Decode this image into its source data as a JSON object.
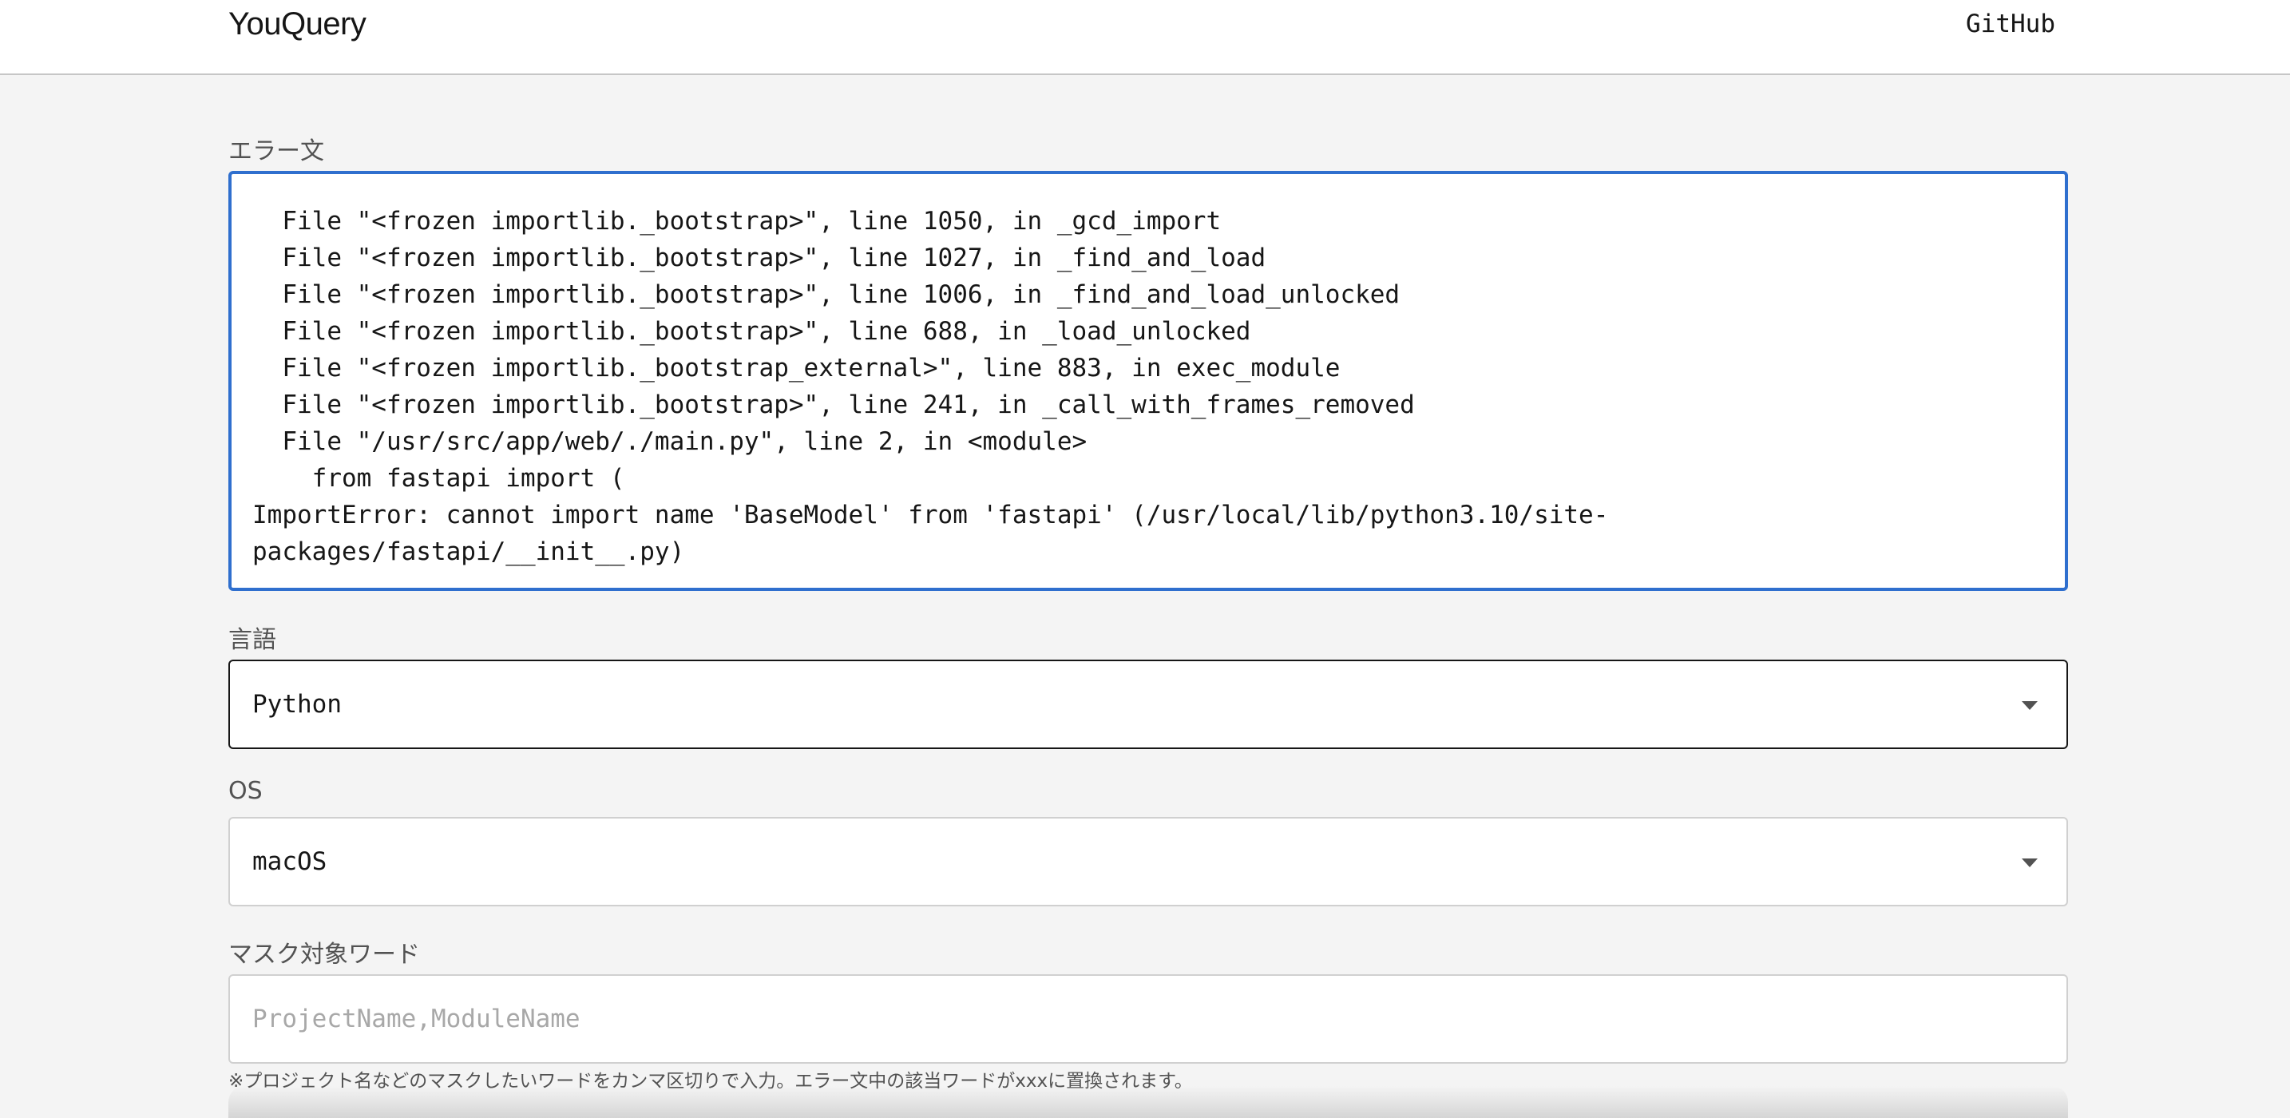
{
  "header": {
    "brand": "YouQuery",
    "github_label": "GitHub"
  },
  "form": {
    "error_label": "エラー文",
    "error_text": "  File \"<frozen importlib._bootstrap>\", line 1050, in _gcd_import\n  File \"<frozen importlib._bootstrap>\", line 1027, in _find_and_load\n  File \"<frozen importlib._bootstrap>\", line 1006, in _find_and_load_unlocked\n  File \"<frozen importlib._bootstrap>\", line 688, in _load_unlocked\n  File \"<frozen importlib._bootstrap_external>\", line 883, in exec_module\n  File \"<frozen importlib._bootstrap>\", line 241, in _call_with_frames_removed\n  File \"/usr/src/app/web/./main.py\", line 2, in <module>\n    from fastapi import (\nImportError: cannot import name 'BaseModel' from 'fastapi' (/usr/local/lib/python3.10/site-\npackages/fastapi/__init__.py)",
    "language_label": "言語",
    "language_value": "Python",
    "os_label": "OS",
    "os_value": "macOS",
    "mask_label": "マスク対象ワード",
    "mask_placeholder": "ProjectName,ModuleName",
    "mask_value": "",
    "mask_helper": "※プロジェクト名などのマスクしたいワードをカンマ区切りで入力。エラー文中の該当ワードがxxxに置換されます。"
  },
  "icons": {
    "language_chevron": "chevron-down-icon",
    "os_chevron": "chevron-down-icon"
  },
  "colors": {
    "focus_border": "#2f6fce",
    "background": "#f4f4f4"
  }
}
